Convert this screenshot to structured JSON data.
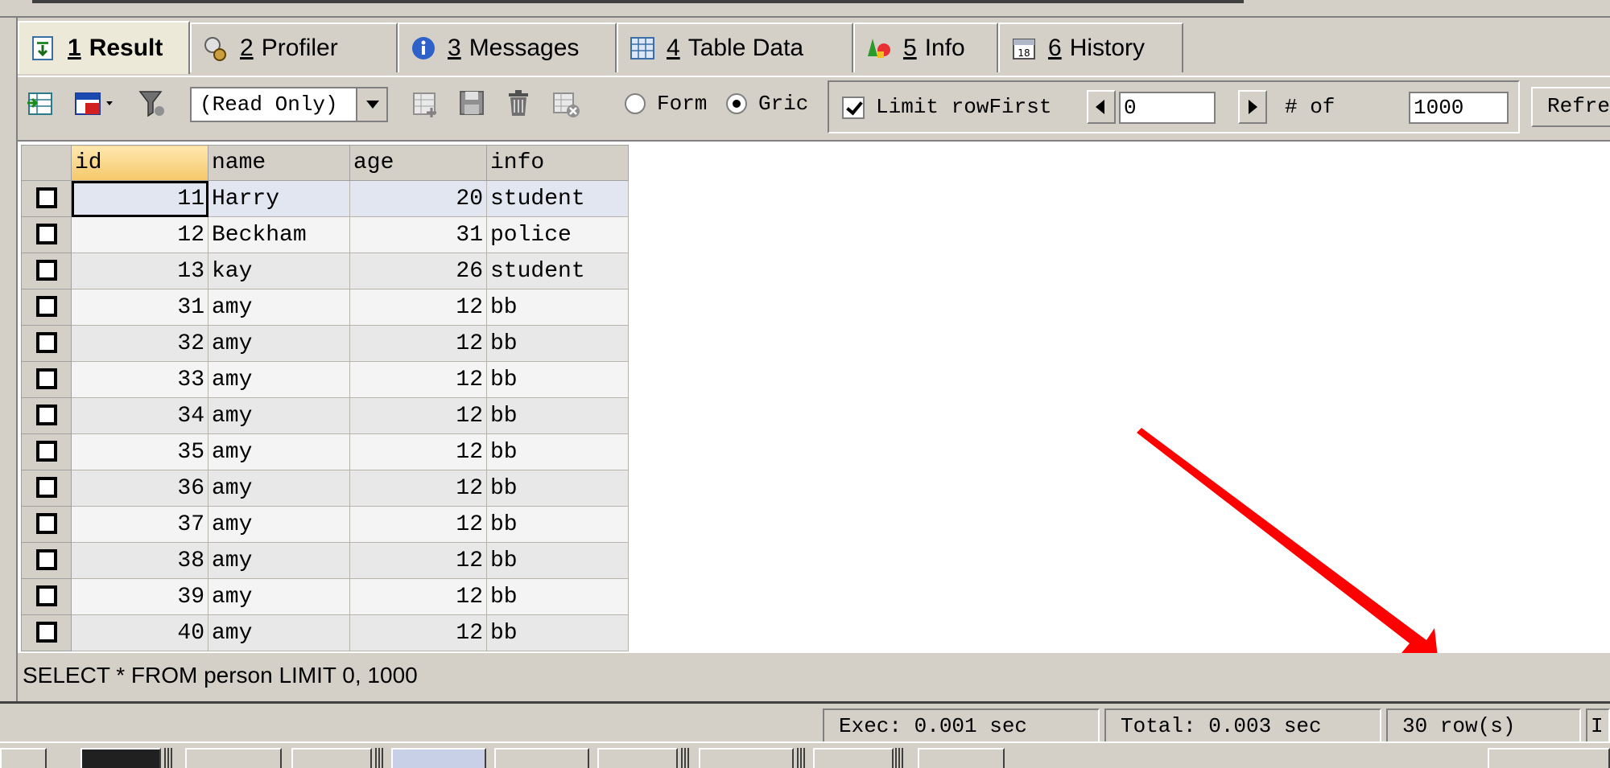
{
  "tabs": [
    {
      "num": "1",
      "label": "Result",
      "icon": "result-icon",
      "active": true
    },
    {
      "num": "2",
      "label": "Profiler",
      "icon": "profiler-icon"
    },
    {
      "num": "3",
      "label": "Messages",
      "icon": "info-circle-icon"
    },
    {
      "num": "4",
      "label": "Table Data",
      "icon": "table-grid-icon"
    },
    {
      "num": "5",
      "label": "Info",
      "icon": "shapes-icon"
    },
    {
      "num": "6",
      "label": "History",
      "icon": "calendar-icon"
    }
  ],
  "toolbar": {
    "select_value": "(Read Only)",
    "form_label": "Form",
    "grid_label": "Gric",
    "limit_label": "Limit row",
    "first_label": "First",
    "first_value": "0",
    "count_label": "# of",
    "count_value": "1000",
    "refresh_label": "Refresh"
  },
  "columns": [
    "id",
    "name",
    "age",
    "info"
  ],
  "rows": [
    [
      "11",
      "Harry",
      "20",
      "student"
    ],
    [
      "12",
      "Beckham",
      "31",
      "police"
    ],
    [
      "13",
      "kay",
      "26",
      "student"
    ],
    [
      "31",
      "amy",
      "12",
      "bb"
    ],
    [
      "32",
      "amy",
      "12",
      "bb"
    ],
    [
      "33",
      "amy",
      "12",
      "bb"
    ],
    [
      "34",
      "amy",
      "12",
      "bb"
    ],
    [
      "35",
      "amy",
      "12",
      "bb"
    ],
    [
      "36",
      "amy",
      "12",
      "bb"
    ],
    [
      "37",
      "amy",
      "12",
      "bb"
    ],
    [
      "38",
      "amy",
      "12",
      "bb"
    ],
    [
      "39",
      "amy",
      "12",
      "bb"
    ],
    [
      "40",
      "amy",
      "12",
      "bb"
    ]
  ],
  "sql": "SELECT * FROM person LIMIT 0, 1000",
  "status": {
    "exec": "Exec: 0.001 sec",
    "total": "Total: 0.003 sec",
    "rows": "30 row(s)",
    "extra": "I"
  },
  "colors": {
    "annotation_arrow": "#ff0000",
    "panel": "#d4d0c8"
  }
}
